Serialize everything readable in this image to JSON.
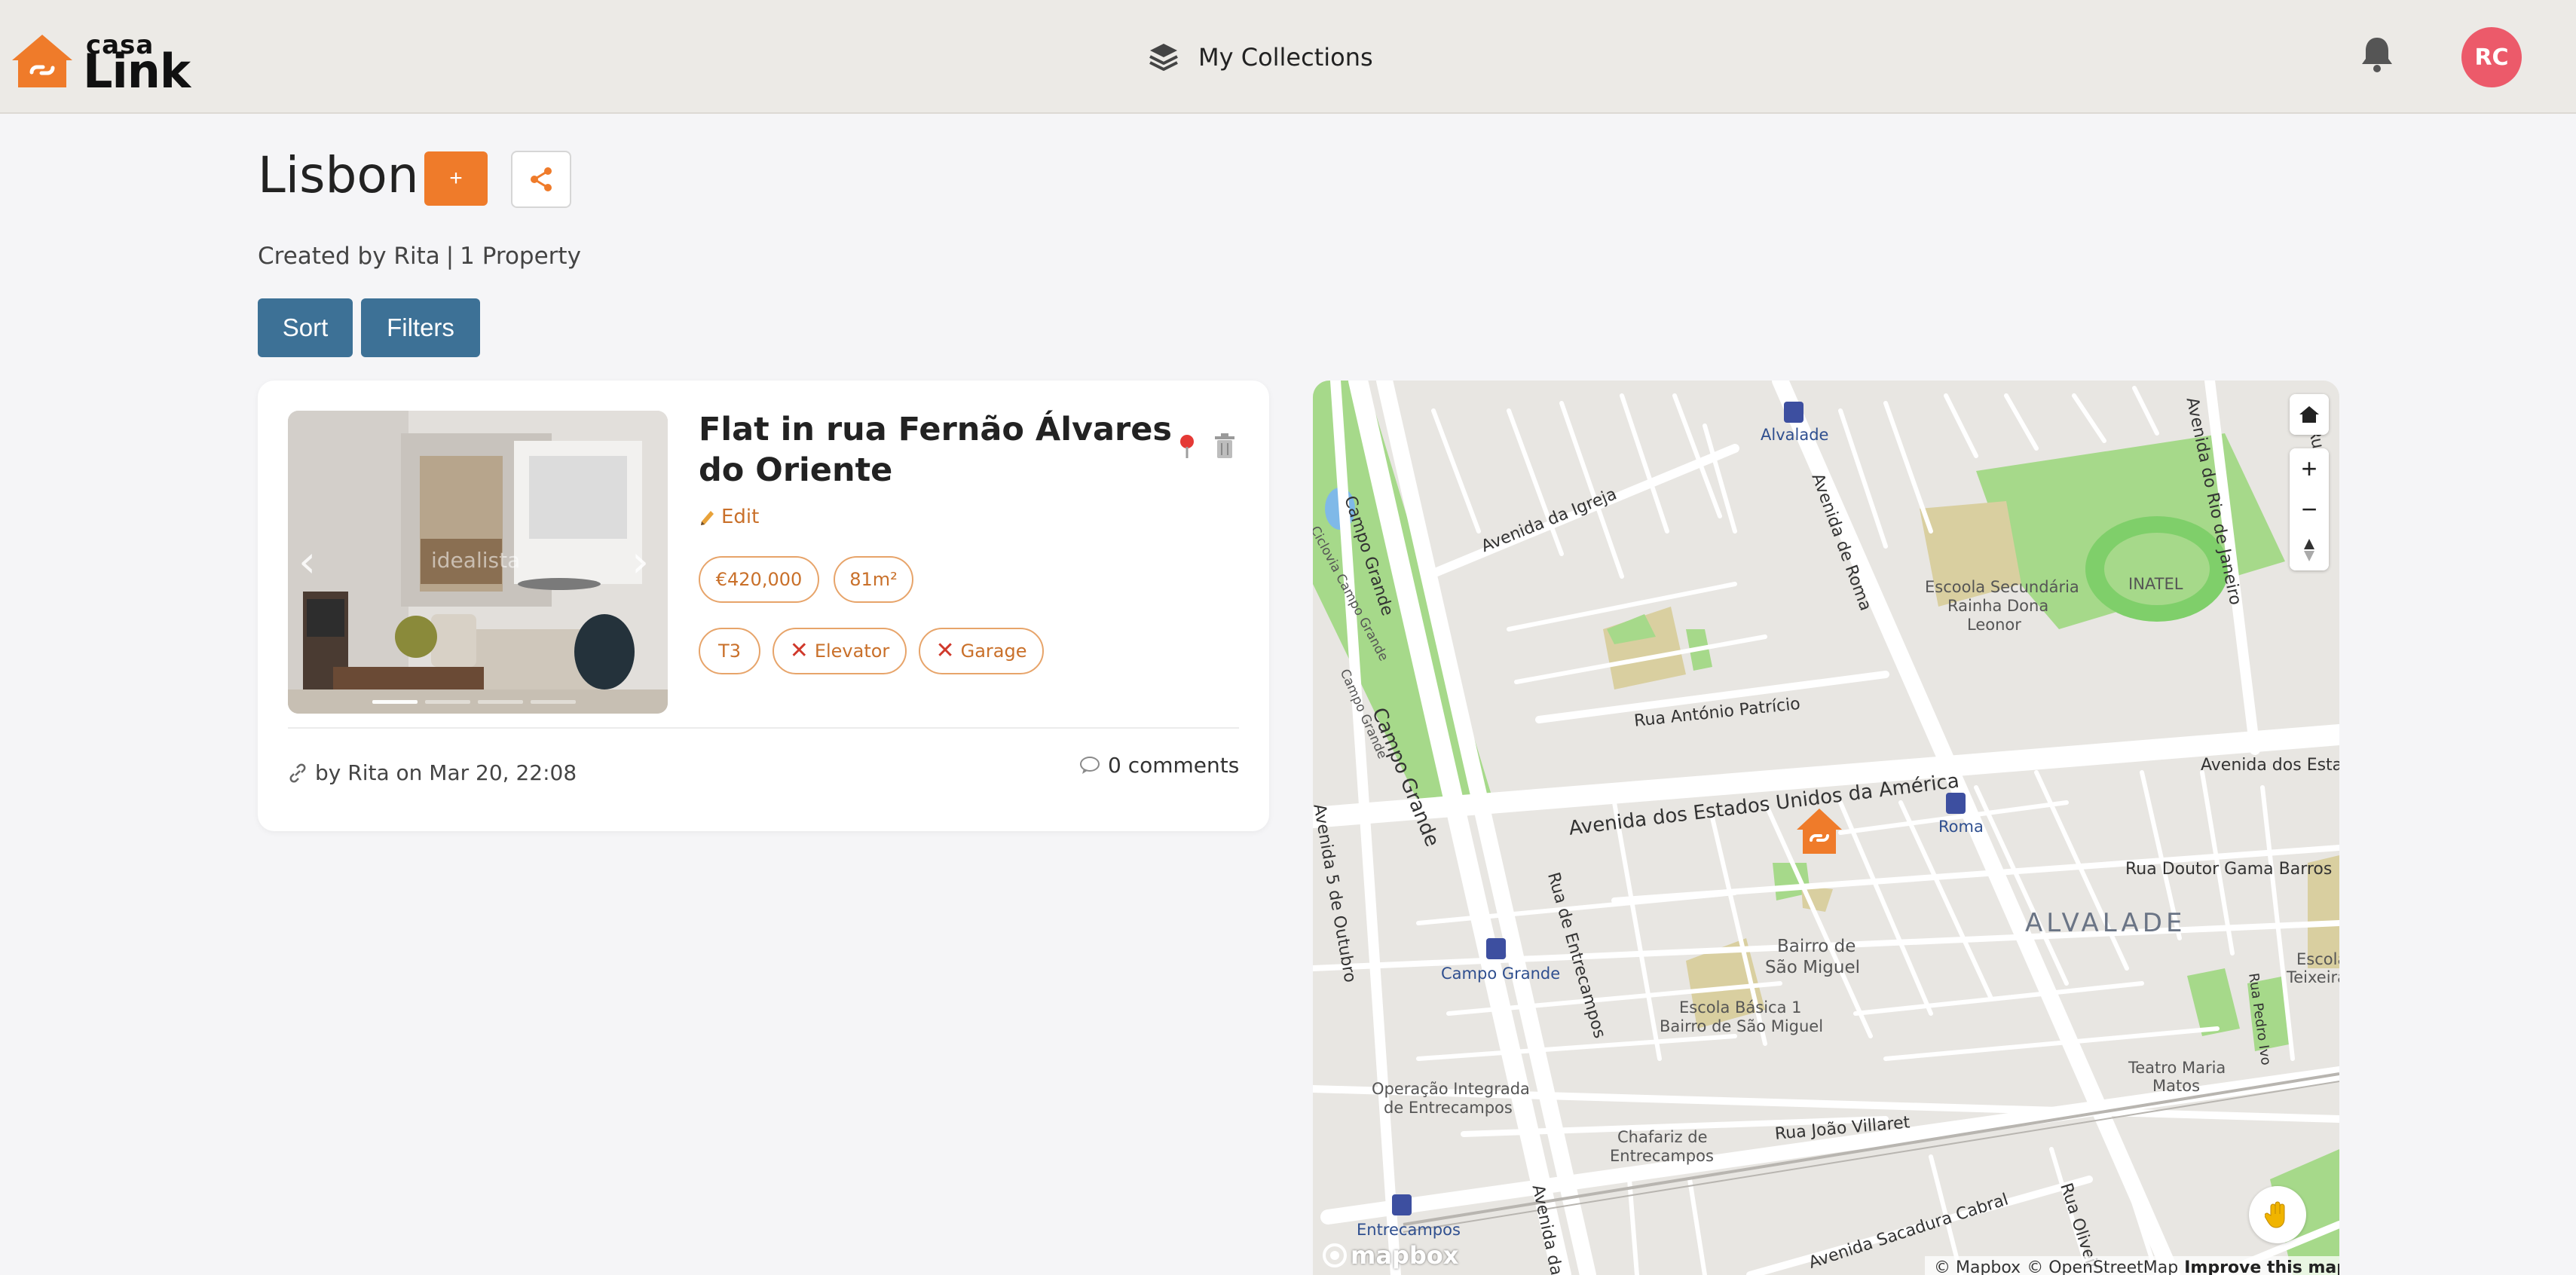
{
  "app": {
    "logo_small": "casa",
    "logo_big": "Link",
    "nav_collections": "My Collections",
    "avatar_initials": "RC"
  },
  "collection": {
    "title": "Lisbon",
    "add_label": "+",
    "created_by": "Created by Rita",
    "separator": "|",
    "property_count": "1 Property",
    "sort_label": "Sort",
    "filters_label": "Filters"
  },
  "property": {
    "title": "Flat in rua Fernão Álvares do Oriente",
    "edit_label": "Edit",
    "photo_watermark": "idealista",
    "price": "€420,000",
    "area": "81m²",
    "typology": "T3",
    "elevator": "Elevator",
    "garage": "Garage",
    "added_by": "by Rita on Mar 20, 22:08",
    "comments": "0 comments",
    "photo_count": 4,
    "photo_index": 1
  },
  "map": {
    "labels": {
      "alvalade": "Alvalade",
      "campo_grande": "Campo Grande",
      "av_igreja": "Avenida da Igreja",
      "av_roma": "Avenida de Roma",
      "av_rio_janeiro": "Avenida do Rio de Janeiro",
      "escola_rainha_1": "Escoola Secundária",
      "escola_rainha_2": "Rainha Dona",
      "escola_rainha_3": "Leonor",
      "inatel": "INATEL",
      "ciclovia": "Ciclovia Campo Grande",
      "campo_grande_small": "Campo Grande",
      "rua_antonio_patricio": "Rua António Patrício",
      "av_eua": "Avenida dos Estados Unidos da América",
      "av_estados_short": "Avenida dos Esta",
      "roma": "Roma",
      "rua_doutor_gama": "Rua Doutor Gama Barros",
      "alvalade_district": "ALVALADE",
      "av_5_outubro": "Avenida 5 de Outubro",
      "rua_entrecampos": "Rua de Entrecampos",
      "campo_grande_station": "Campo Grande",
      "bairro_1": "Bairro de",
      "bairro_2": "São Miguel",
      "escola_basica_1": "Escola Básica 1",
      "escola_basica_2": "Bairro de São Miguel",
      "escola_teixeira_1": "Escola",
      "escola_teixeira_2": "Teixeira",
      "rua_pedro_ivo": "Rua Pedro Ivo",
      "teatro_1": "Teatro Maria",
      "teatro_2": "Matos",
      "operacao_1": "Operação Integrada",
      "operacao_2": "de Entrecampos",
      "chafariz_1": "Chafariz de",
      "chafariz_2": "Entrecampos",
      "rua_joao_villaret": "Rua João Villaret",
      "entrecampos": "Entrecampos",
      "avenida_da": "Avenida da",
      "av_sacadura": "Avenida Sacadura Cabral",
      "rua_oliveira": "Rua Oliveir",
      "ru_edge": "Ru"
    },
    "mapbox_logo": "mapbox",
    "attribution_mapbox": "© Mapbox",
    "attribution_osm": "© OpenStreetMap",
    "attribution_improve": "Improve this map"
  },
  "colors": {
    "accent_orange": "#ef7b2a",
    "button_blue": "#3d7196",
    "avatar_pink": "#ec5a6a",
    "header_bg": "#eceae6",
    "park_green": "#a6d98a"
  }
}
